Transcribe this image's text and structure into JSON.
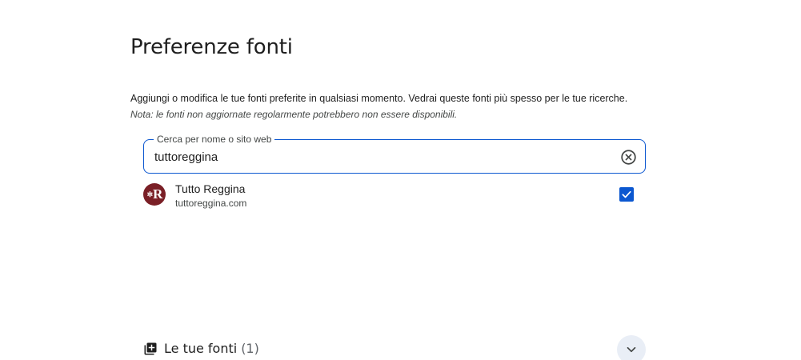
{
  "page": {
    "title": "Preferenze fonti",
    "description": "Aggiungi o modifica le tue fonti preferite in qualsiasi momento. Vedrai queste fonti più spesso per le tue ricerche.",
    "note": "Nota: le fonti non aggiornate regolarmente potrebbero non essere disponibili."
  },
  "search": {
    "label": "Cerca per nome o sito web",
    "value": "tuttoreggina",
    "clear_icon": "close-circle-icon"
  },
  "results": [
    {
      "name": "Tutto Reggina",
      "url": "tuttoreggina.com",
      "logo_text": "R",
      "checked": true
    }
  ],
  "your_sources": {
    "title": "Le tue fonti",
    "count": "(1)",
    "icon": "library-add-icon",
    "expand_icon": "chevron-down-icon"
  },
  "colors": {
    "accent": "#0b57d0",
    "logo_bg": "#7a1f26",
    "expand_bg": "#e9eef6"
  }
}
